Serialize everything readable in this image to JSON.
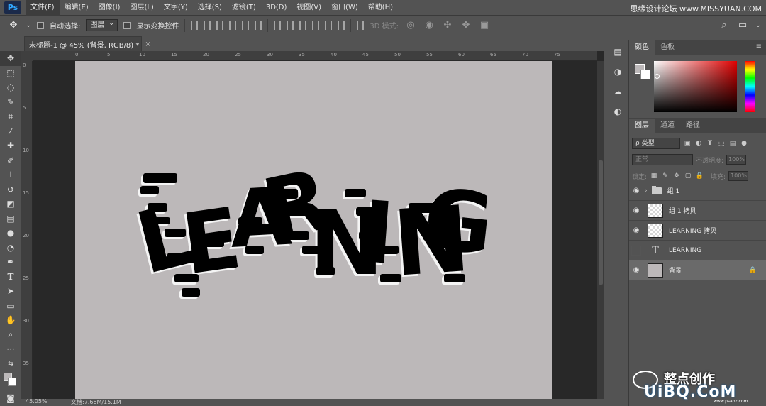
{
  "app": {
    "logo": "Ps",
    "watermark_top": "思缘设计论坛 www.MISSYUAN.COM"
  },
  "menu": [
    {
      "label": "文件(F)",
      "active": true
    },
    {
      "label": "编辑(E)"
    },
    {
      "label": "图像(I)"
    },
    {
      "label": "图层(L)"
    },
    {
      "label": "文字(Y)"
    },
    {
      "label": "选择(S)"
    },
    {
      "label": "滤镜(T)"
    },
    {
      "label": "3D(D)"
    },
    {
      "label": "视图(V)"
    },
    {
      "label": "窗口(W)"
    },
    {
      "label": "帮助(H)"
    }
  ],
  "options": {
    "auto_select_label": "自动选择:",
    "auto_select_value": "图层",
    "show_transform_label": "显示变换控件",
    "mode_3d_label": "3D 模式:"
  },
  "document": {
    "tab_title": "未标题-1 @ 45% (背景, RGB/8) *",
    "close": "×",
    "canvas_color": "#bcb8b9",
    "artwork_text": "LEARNING",
    "ruler_top_labels": [
      "0",
      "5",
      "10",
      "15",
      "20",
      "25",
      "30",
      "35",
      "40",
      "45",
      "50",
      "55",
      "60",
      "65",
      "70",
      "75"
    ],
    "ruler_left_labels": [
      "0",
      "5",
      "10",
      "15",
      "20",
      "25",
      "30",
      "35"
    ]
  },
  "status": {
    "zoom": "45.05%",
    "doc_size": "文档:7.66M/15.1M"
  },
  "color_panel": {
    "tabs": [
      "颜色",
      "色板"
    ],
    "active_tab": 0,
    "fg": "#bcb8b9",
    "bg": "#ffffff"
  },
  "layers_panel": {
    "tabs": [
      "图层",
      "通道",
      "路径"
    ],
    "active_tab": 0,
    "filter_label": "ρ 类型",
    "blend_mode": "正常",
    "opacity_label": "不透明度:",
    "opacity_value": "100%",
    "lock_label": "锁定:",
    "fill_label": "填充:",
    "fill_value": "100%",
    "layers": [
      {
        "name": "组 1",
        "kind": "group",
        "visible": true
      },
      {
        "name": "组 1 拷贝",
        "kind": "pixel",
        "visible": true
      },
      {
        "name": "LEARNING 拷贝",
        "kind": "pixel",
        "visible": true
      },
      {
        "name": "LEARNING",
        "kind": "type",
        "visible": false
      },
      {
        "name": "背景",
        "kind": "background",
        "visible": true,
        "locked": true,
        "selected": true
      }
    ]
  },
  "brand": {
    "cn": "整点创作",
    "en": "UiBQ.CoM",
    "sub": "www.psahz.com"
  }
}
